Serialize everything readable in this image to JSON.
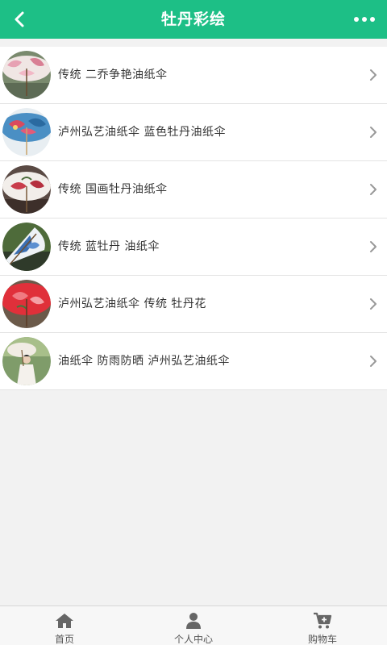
{
  "header": {
    "title": "牡丹彩绘",
    "bg_color": "#1dbf86"
  },
  "items": [
    {
      "label": "传统 二乔争艳油纸伞",
      "thumb": "parasol-pink-white"
    },
    {
      "label": "泸州弘艺油纸伞 蓝色牡丹油纸伞",
      "thumb": "parasol-blue-peony"
    },
    {
      "label": "传统 国画牡丹油纸伞",
      "thumb": "parasol-white-red-peony"
    },
    {
      "label": "传统 蓝牡丹 油纸伞",
      "thumb": "parasol-blue-side"
    },
    {
      "label": "泸州弘艺油纸伞 传统 牡丹花",
      "thumb": "parasol-red-peony"
    },
    {
      "label": "油纸伞 防雨防晒 泸州弘艺油纸伞",
      "thumb": "woman-with-parasol"
    }
  ],
  "tabbar": {
    "home": "首页",
    "profile": "个人中心",
    "cart": "购物车"
  },
  "icons": {
    "back": "chevron-left-icon",
    "more": "more-dots-icon",
    "row": "chevron-right-icon",
    "home": "home-icon",
    "profile": "person-icon",
    "cart": "cart-icon"
  }
}
